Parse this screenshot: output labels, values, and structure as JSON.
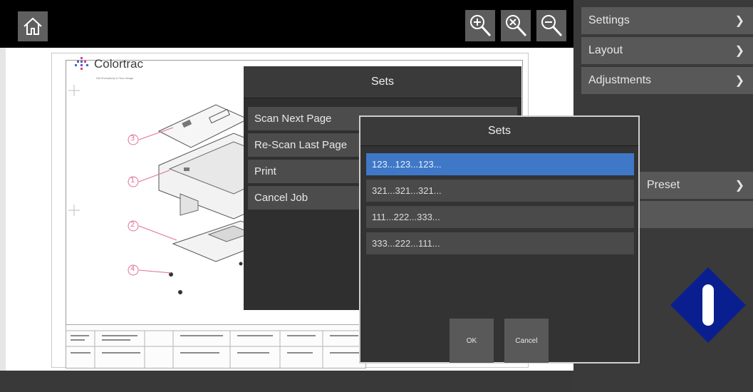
{
  "toolbar": {
    "home_icon": "home-icon",
    "zoom_in_icon": "zoom-in-icon",
    "zoom_fit_icon": "zoom-fit-icon",
    "zoom_out_icon": "zoom-out-icon"
  },
  "preview": {
    "brand_name": "Colortrac",
    "brand_tagline": "Get Everybody in Your Image",
    "callouts": [
      "3",
      "1",
      "2",
      "4"
    ]
  },
  "sidebar": {
    "items": [
      {
        "label": "Settings"
      },
      {
        "label": "Layout"
      },
      {
        "label": "Adjustments"
      },
      {
        "label": "Preset"
      },
      {
        "label": ""
      }
    ]
  },
  "sets_dialog": {
    "title": "Sets",
    "items": [
      {
        "label": "Scan Next Page"
      },
      {
        "label": "Re-Scan Last Page"
      },
      {
        "label": "Print"
      },
      {
        "label": "Cancel Job"
      }
    ]
  },
  "sets_popup": {
    "title": "Sets",
    "options": [
      {
        "label": "123...123...123...",
        "selected": true
      },
      {
        "label": "321...321...321...",
        "selected": false
      },
      {
        "label": "111...222...333...",
        "selected": false
      },
      {
        "label": "333...222...111...",
        "selected": false
      }
    ],
    "ok_label": "OK",
    "cancel_label": "Cancel"
  },
  "colors": {
    "selected": "#3f78c7",
    "indicator": "#0a1f8f"
  }
}
